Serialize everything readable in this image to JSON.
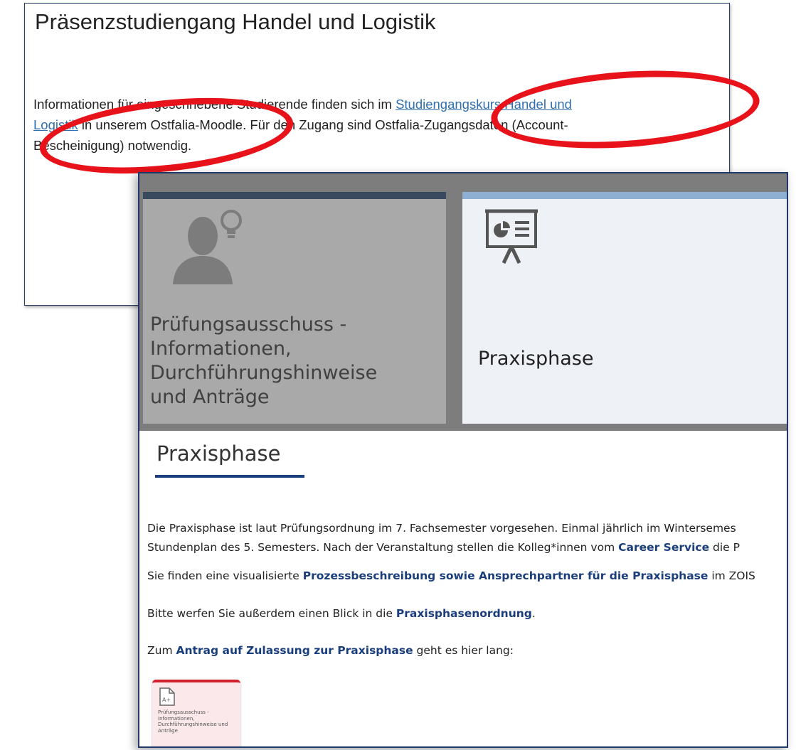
{
  "top": {
    "title": "Präsenzstudiengang Handel und Logistik",
    "para_line1_before": "Informationen für eingeschriebene Studierende finden sich im ",
    "link_line1": "Studiengangskurs Handel und",
    "link_line2": "Logistik",
    "para_line2_after": " in unserem Ostfalia-Moodle. Für den Zugang sind Ostfalia-Zugangsdaten (Account-",
    "para_line3": "Bescheinigung) notwendig."
  },
  "tiles": {
    "pruefung_label": "Prüfungsausschuss - Informationen, Durchführungshinweise und Anträge",
    "praxis_label": "Praxisphase",
    "pruefung_icon": "person-lightbulb-icon",
    "praxis_icon": "presentation-board-icon"
  },
  "section": {
    "heading": "Praxisphase",
    "p1_l1": "Die Praxisphase ist laut Prüfungsordnung im 7. Fachsemester vorgesehen. Einmal jährlich im Wintersemes",
    "p1_l2_before": "Stundenplan des 5. Semesters. Nach der Veranstaltung stellen die Kolleg*innen vom ",
    "p1_l2_bold": "Career Service",
    "p1_l2_after": " die P",
    "p2_before": "Sie finden eine visualisierte ",
    "p2_bold": "Prozessbeschreibung sowie Ansprechpartner für die Praxisphase",
    "p2_after": " im ZOIS",
    "p3_before": "Bitte werfen Sie außerdem einen Blick in die ",
    "p3_bold": "Praxisphasenordnung",
    "p3_after": ".",
    "p4_before": "Zum ",
    "p4_bold": "Antrag auf Zulassung zur Praxisphase",
    "p4_after": " geht es hier lang:"
  },
  "file_card": {
    "icon": "document-a-plus-icon",
    "icon_text": "A+",
    "label": "Prüfungsausschuss - Informationen, Durchführungshinweise und Anträge"
  },
  "colors": {
    "annotation_red": "#e8121a",
    "link_blue": "#2f6fae",
    "accent_navy": "#1a3d7c"
  }
}
